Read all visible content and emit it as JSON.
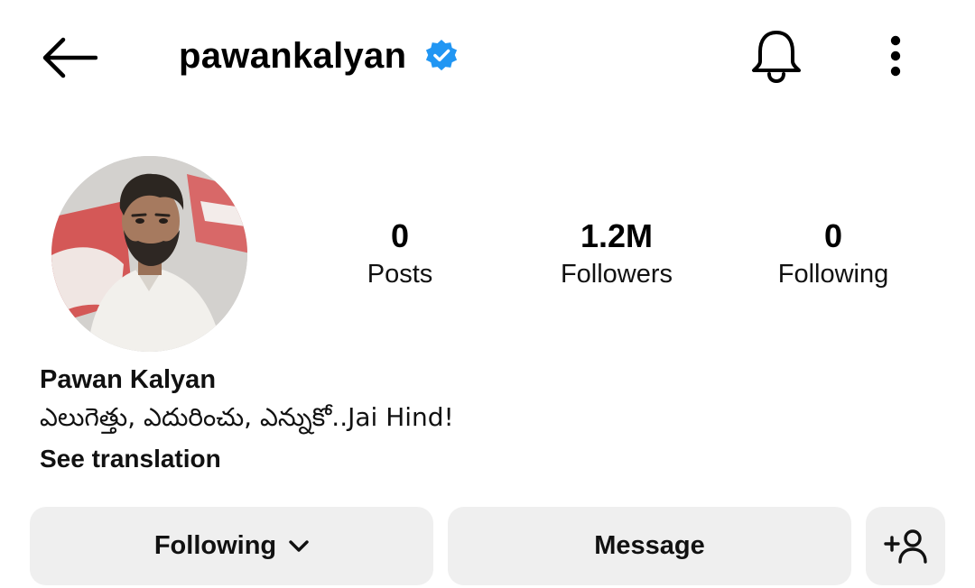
{
  "header": {
    "username": "pawankalyan",
    "icons": {
      "back": "arrow-left-icon",
      "verified": "verified-badge-icon",
      "notifications": "bell-icon",
      "more": "more-vertical-icon"
    },
    "colors": {
      "verified": "#2196f3"
    }
  },
  "profile": {
    "full_name": "Pawan Kalyan",
    "bio": "ఎలుగెత్తు, ఎదురించు, ఎన్నుకో..Jai Hind!",
    "see_translation": "See translation"
  },
  "stats": [
    {
      "value": "0",
      "label": "Posts"
    },
    {
      "value": "1.2M",
      "label": "Followers"
    },
    {
      "value": "0",
      "label": "Following"
    }
  ],
  "actions": {
    "following": "Following",
    "message": "Message",
    "icons": {
      "dropdown": "chevron-down-icon",
      "add_user": "add-user-icon"
    }
  },
  "colors": {
    "button_bg": "#efefef",
    "text": "#111111"
  }
}
